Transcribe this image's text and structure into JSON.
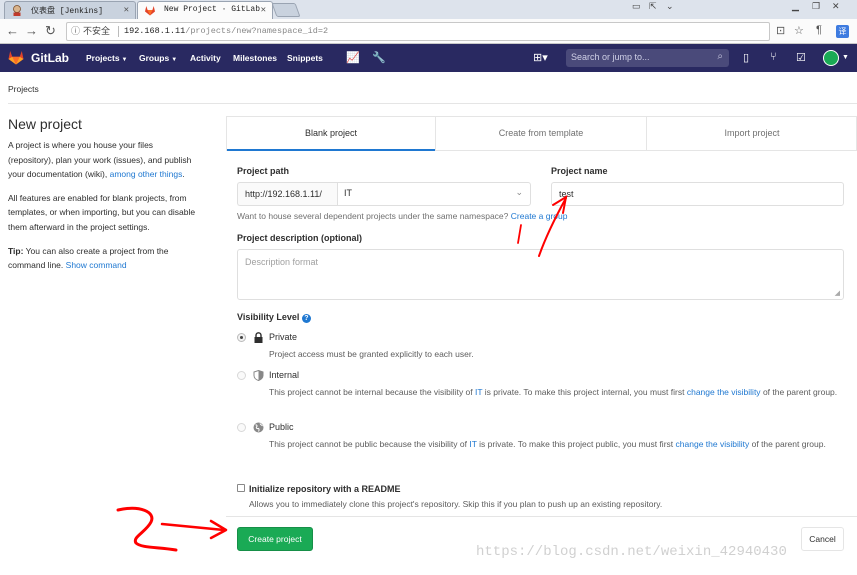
{
  "browser": {
    "tabs": [
      {
        "title": "仪表盘 [Jenkins]",
        "active": false
      },
      {
        "title": "New Project · GitLab",
        "active": true
      }
    ],
    "security_label": "不安全",
    "url_host": "192.168.1.11",
    "url_path": "/projects/new?namespace_id=2"
  },
  "gitlab_nav": {
    "brand": "GitLab",
    "menu": [
      "Projects",
      "Groups",
      "Activity",
      "Milestones",
      "Snippets"
    ],
    "search_placeholder": "Search or jump to..."
  },
  "breadcrumb": "Projects",
  "sidebar": {
    "title": "New project",
    "intro_text": "A project is where you house your files (repository), plan your work (issues), and publish your documentation (wiki),",
    "intro_link": "among other things",
    "blank_text": "All features are enabled for blank projects, from templates, or when importing, but you can disable them afterward in the project settings.",
    "tip_label": "Tip:",
    "tip_text": "You can also create a project from the command line.",
    "tip_link": "Show command"
  },
  "tabs": [
    "Blank project",
    "Create from template",
    "Import project"
  ],
  "form": {
    "path_label": "Project path",
    "path_prefix": "http://192.168.1.11/",
    "namespace_value": "IT",
    "name_label": "Project name",
    "name_value": "test",
    "namespace_help": "Want to house several dependent projects under the same namespace?",
    "namespace_help_link": "Create a group",
    "description_label": "Project description (optional)",
    "description_placeholder": "Description format",
    "visibility_label": "Visibility Level",
    "visibility_options": [
      {
        "title": "Private",
        "desc": "Project access must be granted explicitly to each user.",
        "checked": true
      },
      {
        "title": "Internal",
        "desc_pre": "This project cannot be internal because the visibility of",
        "desc_link1": "IT",
        "desc_mid": "is private. To make this project internal, you must first",
        "desc_link2": "change the visibility",
        "desc_post": "of the parent group.",
        "checked": false
      },
      {
        "title": "Public",
        "desc_pre": "This project cannot be public because the visibility of",
        "desc_link1": "IT",
        "desc_mid": "is private. To make this project public, you must first",
        "desc_link2": "change the visibility",
        "desc_post": "of the parent group.",
        "checked": false
      }
    ],
    "readme_label": "Initialize repository with a README",
    "readme_desc": "Allows you to immediately clone this project's repository. Skip this if you plan to push up an existing repository.",
    "create_button": "Create project",
    "cancel_button": "Cancel"
  },
  "watermark": "https://blog.csdn.net/weixin_42940430",
  "colors": {
    "navbar": "#292961",
    "create_button": "#1aaa55",
    "link": "#1f78d1",
    "annotation": "#ff0000"
  }
}
